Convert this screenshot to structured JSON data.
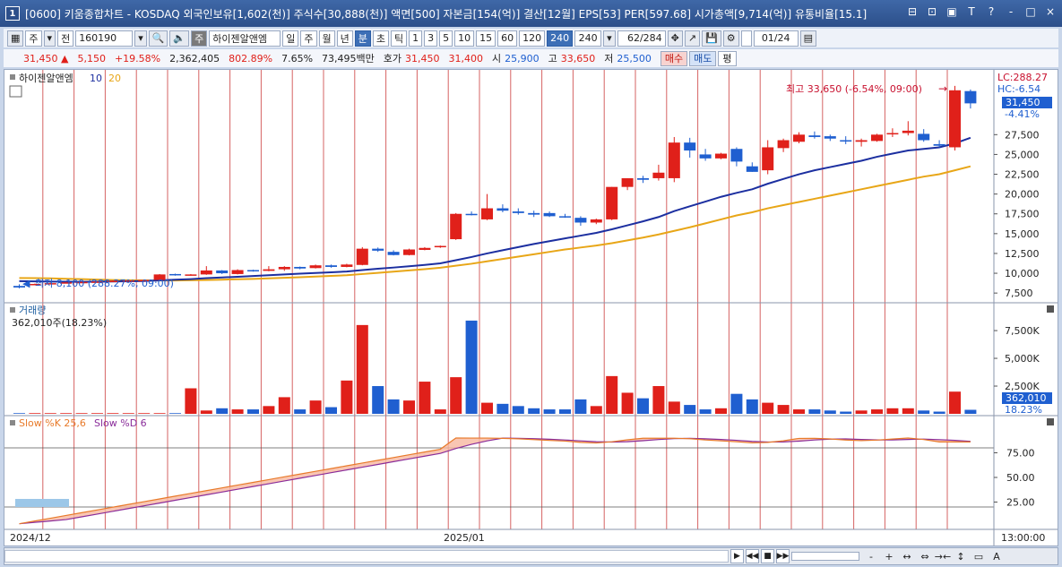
{
  "window": {
    "number": "1",
    "title": "[0600] 키움종합차트 - KOSDAQ 외국인보유[1,602(천)] 주식수[30,888(천)] 액면[500] 자본금[154(억)] 결산[12월] EPS[53] PER[597.68] 시가총액[9,714(억)] 유통비율[15.1]",
    "controls": [
      "⊟",
      "⊡",
      "▣",
      "T",
      "?",
      "-",
      "□",
      "×"
    ]
  },
  "toolbar": {
    "period_main": "주",
    "period_sub": "전",
    "code": "160190",
    "stock_badge": "주",
    "stock_name": "하이젠알앤엠",
    "periods": [
      "일",
      "주",
      "월",
      "년",
      "분",
      "초",
      "틱"
    ],
    "selected_period": "분",
    "intervals": [
      "1",
      "3",
      "5",
      "10",
      "15",
      "60",
      "120",
      "240"
    ],
    "selected_interval": "240",
    "interval_value": "240",
    "count": "62",
    "total": "/284",
    "date": "01/24"
  },
  "quote": {
    "price": "31,450",
    "arrow": "▲",
    "change": "5,150",
    "change_rate": "+19.58%",
    "volume": "2,362,405",
    "volume_ratio": "802.89%",
    "turnover": "7.65%",
    "amount": "73,495백만",
    "hoga_label": "호가",
    "ask": "31,450",
    "bid": "31,400",
    "open_label": "시",
    "open": "25,900",
    "high_label": "고",
    "high": "33,650",
    "low_label": "저",
    "low": "25,500",
    "buy": "매수",
    "sell": "매도",
    "avg": "평"
  },
  "colors": {
    "up": "#e0201a",
    "down": "#1f5fd0",
    "ma10": "#1c2fa0",
    "ma20": "#e8a617",
    "slowk": "#e87a2a",
    "slowd": "#8a2d9a",
    "stoch_fill": "#f7b8a0",
    "vline": "#c83030"
  },
  "price_panel": {
    "name": "하이젠알앤엠",
    "ma_short": "10",
    "ma_long": "20",
    "high_note": "최고 33,650 (-6.54%, 09:00)",
    "low_note": "최저 8,100 (288.27%, 09:00)",
    "lc": "LC:288.27",
    "hc": "HC:-6.54",
    "current_tag": "31,450",
    "current_rate": "-4.41%",
    "y_labels": [
      "27,500",
      "25,000",
      "22,500",
      "20,000",
      "17,500",
      "15,000",
      "12,500",
      "10,000",
      "7,500"
    ]
  },
  "volume_panel": {
    "name": "거래량",
    "value": "362,010주(18.23%)",
    "tag": "362,010",
    "tag_rate": "18.23%",
    "y_labels": [
      "7,500K",
      "5,000K",
      "2,500K"
    ]
  },
  "stoch_panel": {
    "name_k": "Slow %K 25,6",
    "name_d": "Slow %D 6",
    "y_labels": [
      "75.00",
      "50.00",
      "25.00"
    ]
  },
  "x_axis": {
    "labels": [
      "2024/12",
      "2025/01"
    ],
    "time_label": "13:00:00"
  },
  "chart_data": {
    "type": "candlestick",
    "candles": [
      {
        "o": 8400,
        "h": 8600,
        "l": 8100,
        "c": 8200
      },
      {
        "o": 8600,
        "h": 8700,
        "l": 8500,
        "c": 8650
      },
      {
        "o": 8700,
        "h": 8800,
        "l": 8650,
        "c": 8750
      },
      {
        "o": 8800,
        "h": 8900,
        "l": 8750,
        "c": 8850
      },
      {
        "o": 8900,
        "h": 8950,
        "l": 8800,
        "c": 8900
      },
      {
        "o": 8900,
        "h": 8950,
        "l": 8850,
        "c": 8950
      },
      {
        "o": 9000,
        "h": 9100,
        "l": 8950,
        "c": 9050
      },
      {
        "o": 9050,
        "h": 9150,
        "l": 9000,
        "c": 9100
      },
      {
        "o": 9100,
        "h": 9200,
        "l": 9050,
        "c": 9150
      },
      {
        "o": 9150,
        "h": 9900,
        "l": 9100,
        "c": 9850
      },
      {
        "o": 9900,
        "h": 9950,
        "l": 9700,
        "c": 9750
      },
      {
        "o": 9800,
        "h": 9900,
        "l": 9700,
        "c": 9850
      },
      {
        "o": 9850,
        "h": 10900,
        "l": 9800,
        "c": 10350
      },
      {
        "o": 10350,
        "h": 10400,
        "l": 9900,
        "c": 10000
      },
      {
        "o": 9900,
        "h": 10500,
        "l": 9850,
        "c": 10400
      },
      {
        "o": 10400,
        "h": 10450,
        "l": 10200,
        "c": 10300
      },
      {
        "o": 10300,
        "h": 10900,
        "l": 10250,
        "c": 10500
      },
      {
        "o": 10500,
        "h": 10900,
        "l": 10300,
        "c": 10800
      },
      {
        "o": 10800,
        "h": 10850,
        "l": 10500,
        "c": 10600
      },
      {
        "o": 10650,
        "h": 11100,
        "l": 10600,
        "c": 11000
      },
      {
        "o": 11000,
        "h": 11100,
        "l": 10700,
        "c": 10800
      },
      {
        "o": 10800,
        "h": 11200,
        "l": 10750,
        "c": 11100
      },
      {
        "o": 11050,
        "h": 13300,
        "l": 11000,
        "c": 13100
      },
      {
        "o": 13100,
        "h": 13250,
        "l": 12700,
        "c": 12850
      },
      {
        "o": 12700,
        "h": 12900,
        "l": 12250,
        "c": 12300
      },
      {
        "o": 12300,
        "h": 13100,
        "l": 12250,
        "c": 13000
      },
      {
        "o": 12950,
        "h": 13300,
        "l": 12900,
        "c": 13200
      },
      {
        "o": 13300,
        "h": 13500,
        "l": 13200,
        "c": 13450
      },
      {
        "o": 14300,
        "h": 17600,
        "l": 14200,
        "c": 17500
      },
      {
        "o": 17500,
        "h": 17800,
        "l": 17300,
        "c": 17450
      },
      {
        "o": 16800,
        "h": 20000,
        "l": 16700,
        "c": 18200
      },
      {
        "o": 18200,
        "h": 18700,
        "l": 17700,
        "c": 17900
      },
      {
        "o": 17800,
        "h": 18200,
        "l": 17400,
        "c": 17600
      },
      {
        "o": 17600,
        "h": 17900,
        "l": 17100,
        "c": 17400
      },
      {
        "o": 17600,
        "h": 17800,
        "l": 17100,
        "c": 17200
      },
      {
        "o": 17200,
        "h": 17500,
        "l": 17000,
        "c": 17100
      },
      {
        "o": 17000,
        "h": 17200,
        "l": 16000,
        "c": 16400
      },
      {
        "o": 16400,
        "h": 16900,
        "l": 16200,
        "c": 16800
      },
      {
        "o": 16800,
        "h": 20900,
        "l": 16700,
        "c": 20900
      },
      {
        "o": 20900,
        "h": 22000,
        "l": 20500,
        "c": 22000
      },
      {
        "o": 22000,
        "h": 22300,
        "l": 21400,
        "c": 21800
      },
      {
        "o": 22000,
        "h": 23700,
        "l": 21700,
        "c": 22700
      },
      {
        "o": 22000,
        "h": 27200,
        "l": 21500,
        "c": 26500
      },
      {
        "o": 26500,
        "h": 27100,
        "l": 24600,
        "c": 25500
      },
      {
        "o": 25000,
        "h": 25700,
        "l": 24200,
        "c": 24500
      },
      {
        "o": 24500,
        "h": 25200,
        "l": 24400,
        "c": 25100
      },
      {
        "o": 25700,
        "h": 25900,
        "l": 23500,
        "c": 24100
      },
      {
        "o": 23500,
        "h": 24000,
        "l": 22800,
        "c": 22800
      },
      {
        "o": 23000,
        "h": 26800,
        "l": 22500,
        "c": 25900
      },
      {
        "o": 25800,
        "h": 27000,
        "l": 25300,
        "c": 26800
      },
      {
        "o": 26600,
        "h": 27800,
        "l": 26400,
        "c": 27500
      },
      {
        "o": 27400,
        "h": 27900,
        "l": 27000,
        "c": 27200
      },
      {
        "o": 27300,
        "h": 27500,
        "l": 26700,
        "c": 27000
      },
      {
        "o": 26800,
        "h": 27300,
        "l": 26300,
        "c": 26700
      },
      {
        "o": 26600,
        "h": 27000,
        "l": 26000,
        "c": 26800
      },
      {
        "o": 26700,
        "h": 27600,
        "l": 26600,
        "c": 27500
      },
      {
        "o": 27600,
        "h": 28300,
        "l": 27200,
        "c": 27700
      },
      {
        "o": 27700,
        "h": 29200,
        "l": 27400,
        "c": 28000
      },
      {
        "o": 27600,
        "h": 28200,
        "l": 26600,
        "c": 26800
      },
      {
        "o": 26300,
        "h": 26800,
        "l": 25900,
        "c": 26100
      },
      {
        "o": 25900,
        "h": 33650,
        "l": 25500,
        "c": 33100
      },
      {
        "o": 33000,
        "h": 33200,
        "l": 30800,
        "c": 31450
      }
    ],
    "ma10": [
      9000,
      8980,
      8950,
      8930,
      8920,
      8930,
      8960,
      8990,
      9020,
      9100,
      9180,
      9260,
      9380,
      9470,
      9560,
      9650,
      9750,
      9850,
      9950,
      10030,
      10120,
      10220,
      10400,
      10570,
      10720,
      10880,
      11050,
      11250,
      11650,
      12050,
      12500,
      12900,
      13300,
      13700,
      14050,
      14400,
      14750,
      15100,
      15550,
      16050,
      16550,
      17100,
      17850,
      18450,
      19050,
      19650,
      20150,
      20600,
      21300,
      21900,
      22500,
      23000,
      23400,
      23800,
      24200,
      24700,
      25100,
      25500,
      25700,
      25900,
      26400,
      27100
    ],
    "ma20": [
      9400,
      9380,
      9350,
      9300,
      9250,
      9200,
      9150,
      9120,
      9100,
      9090,
      9090,
      9110,
      9150,
      9190,
      9240,
      9290,
      9350,
      9420,
      9500,
      9580,
      9660,
      9750,
      9900,
      10050,
      10200,
      10360,
      10520,
      10700,
      10950,
      11200,
      11500,
      11800,
      12100,
      12400,
      12700,
      13000,
      13250,
      13500,
      13800,
      14150,
      14500,
      14900,
      15350,
      15800,
      16300,
      16800,
      17300,
      17700,
      18200,
      18600,
      19000,
      19400,
      19800,
      20200,
      20600,
      21000,
      21400,
      21800,
      22200,
      22500,
      23000,
      23500
    ],
    "volume": [
      60,
      60,
      60,
      60,
      60,
      60,
      60,
      60,
      60,
      60,
      60,
      2300,
      300,
      500,
      400,
      400,
      700,
      1500,
      400,
      1200,
      600,
      3000,
      8000,
      2500,
      1300,
      1200,
      2900,
      400,
      3300,
      8400,
      1000,
      900,
      700,
      500,
      400,
      400,
      1300,
      700,
      3400,
      1900,
      1400,
      2500,
      1100,
      800,
      400,
      500,
      1800,
      1300,
      1000,
      800,
      400,
      400,
      300,
      200,
      300,
      400,
      500,
      500,
      300,
      200,
      2000,
      362
    ]
  }
}
